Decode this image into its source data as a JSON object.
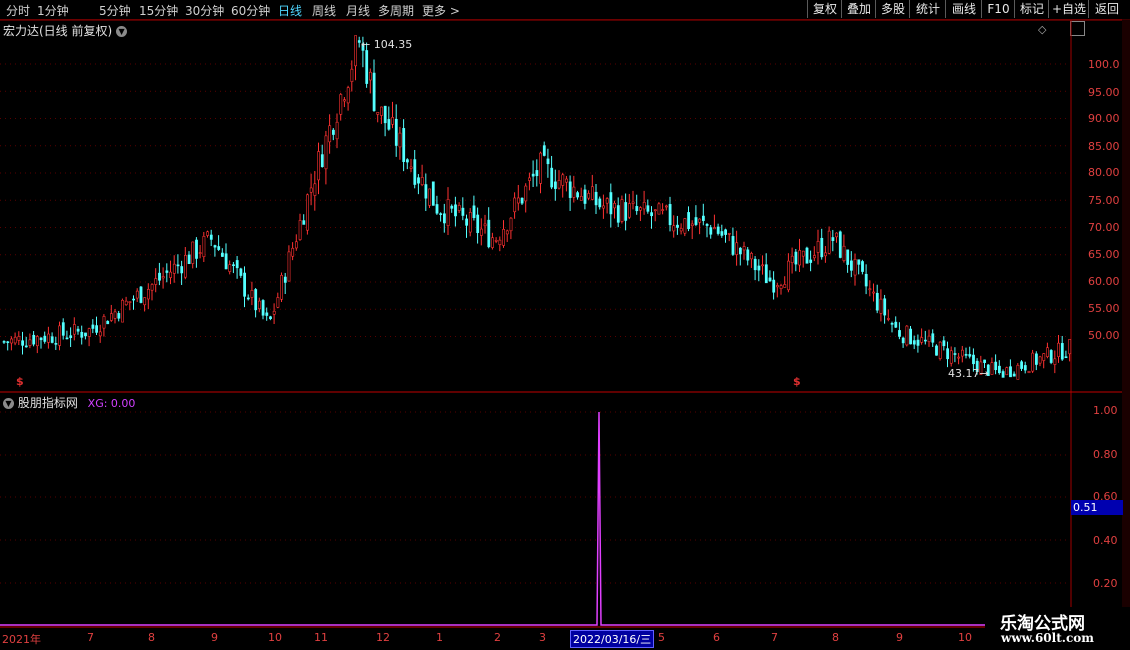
{
  "toolbar": {
    "periods": [
      "分时",
      "1分钟",
      "5分钟",
      "15分钟",
      "30分钟",
      "60分钟",
      "日线",
      "周线",
      "月线",
      "多周期",
      "更多 >"
    ],
    "active_period": "日线",
    "tools": [
      "复权",
      "叠加",
      "多股",
      "统计",
      "画线",
      "F10",
      "标记",
      "+自选",
      "返回"
    ]
  },
  "stock": {
    "title": "宏力达(日线 前复权)"
  },
  "price_axis": [
    "100.0",
    "95.00",
    "90.00",
    "85.00",
    "80.00",
    "75.00",
    "70.00",
    "65.00",
    "60.00",
    "55.00",
    "50.00"
  ],
  "annotations": {
    "high": "104.35",
    "low": "43.17"
  },
  "indicator": {
    "name": "股朋指标网",
    "series": "XG: 0.00",
    "axis": [
      "1.00",
      "0.80",
      "0.60",
      "0.40",
      "0.20"
    ],
    "cursor_value": "0.51"
  },
  "time_axis": {
    "labels": [
      "2021年",
      "7",
      "8",
      "9",
      "10",
      "11",
      "12",
      "1",
      "2",
      "3",
      "5",
      "6",
      "7",
      "8",
      "9",
      "10"
    ],
    "cursor_date": "2022/03/16/三"
  },
  "watermark": {
    "line1": "乐淘公式网",
    "line2": "www.60lt.com"
  },
  "colors": {
    "up": "#ff3232",
    "down": "#54ffff",
    "indicator": "#e040ff",
    "grid": "#5a0000"
  },
  "chart_data": {
    "type": "candlestick",
    "title": "宏力达(日线 前复权)",
    "y_range": [
      43,
      105
    ],
    "key_points": [
      {
        "label": "2021年",
        "close": 49.0
      },
      {
        "label": "7",
        "close": 51.0
      },
      {
        "label": "8",
        "close": 59.0
      },
      {
        "label": "9",
        "close": 68.0
      },
      {
        "label": "10",
        "close": 52.0
      },
      {
        "label": "11",
        "close": 80.0
      },
      {
        "label": "11-high",
        "close": 104.35
      },
      {
        "label": "12",
        "close": 92.0
      },
      {
        "label": "1",
        "close": 74.0
      },
      {
        "label": "2",
        "close": 68.0
      },
      {
        "label": "3",
        "close": 81.0
      },
      {
        "label": "5",
        "close": 74.0
      },
      {
        "label": "6",
        "close": 70.0
      },
      {
        "label": "7",
        "close": 60.0
      },
      {
        "label": "8",
        "close": 68.0
      },
      {
        "label": "9",
        "close": 51.0
      },
      {
        "label": "10-low",
        "close": 43.17
      },
      {
        "label": "10",
        "close": 48.0
      }
    ],
    "indicator_series": {
      "name": "XG",
      "spike_date": "2022/03/16",
      "spike_value": 1.0
    }
  }
}
